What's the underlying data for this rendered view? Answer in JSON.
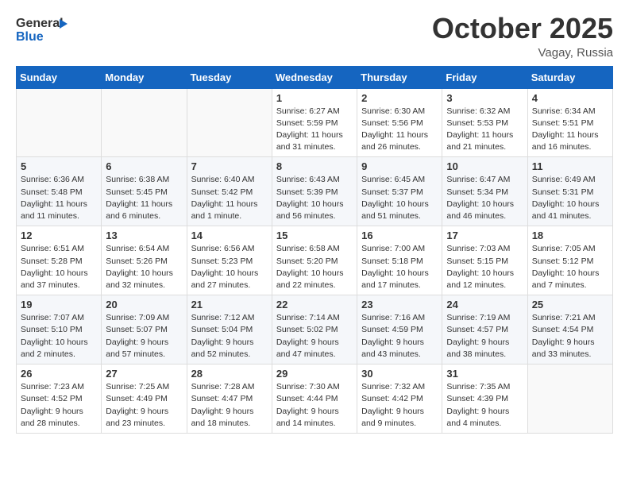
{
  "header": {
    "logo_line1": "General",
    "logo_line2": "Blue",
    "month": "October 2025",
    "location": "Vagay, Russia"
  },
  "weekdays": [
    "Sunday",
    "Monday",
    "Tuesday",
    "Wednesday",
    "Thursday",
    "Friday",
    "Saturday"
  ],
  "weeks": [
    [
      {
        "day": "",
        "info": ""
      },
      {
        "day": "",
        "info": ""
      },
      {
        "day": "",
        "info": ""
      },
      {
        "day": "1",
        "info": "Sunrise: 6:27 AM\nSunset: 5:59 PM\nDaylight: 11 hours\nand 31 minutes."
      },
      {
        "day": "2",
        "info": "Sunrise: 6:30 AM\nSunset: 5:56 PM\nDaylight: 11 hours\nand 26 minutes."
      },
      {
        "day": "3",
        "info": "Sunrise: 6:32 AM\nSunset: 5:53 PM\nDaylight: 11 hours\nand 21 minutes."
      },
      {
        "day": "4",
        "info": "Sunrise: 6:34 AM\nSunset: 5:51 PM\nDaylight: 11 hours\nand 16 minutes."
      }
    ],
    [
      {
        "day": "5",
        "info": "Sunrise: 6:36 AM\nSunset: 5:48 PM\nDaylight: 11 hours\nand 11 minutes."
      },
      {
        "day": "6",
        "info": "Sunrise: 6:38 AM\nSunset: 5:45 PM\nDaylight: 11 hours\nand 6 minutes."
      },
      {
        "day": "7",
        "info": "Sunrise: 6:40 AM\nSunset: 5:42 PM\nDaylight: 11 hours\nand 1 minute."
      },
      {
        "day": "8",
        "info": "Sunrise: 6:43 AM\nSunset: 5:39 PM\nDaylight: 10 hours\nand 56 minutes."
      },
      {
        "day": "9",
        "info": "Sunrise: 6:45 AM\nSunset: 5:37 PM\nDaylight: 10 hours\nand 51 minutes."
      },
      {
        "day": "10",
        "info": "Sunrise: 6:47 AM\nSunset: 5:34 PM\nDaylight: 10 hours\nand 46 minutes."
      },
      {
        "day": "11",
        "info": "Sunrise: 6:49 AM\nSunset: 5:31 PM\nDaylight: 10 hours\nand 41 minutes."
      }
    ],
    [
      {
        "day": "12",
        "info": "Sunrise: 6:51 AM\nSunset: 5:28 PM\nDaylight: 10 hours\nand 37 minutes."
      },
      {
        "day": "13",
        "info": "Sunrise: 6:54 AM\nSunset: 5:26 PM\nDaylight: 10 hours\nand 32 minutes."
      },
      {
        "day": "14",
        "info": "Sunrise: 6:56 AM\nSunset: 5:23 PM\nDaylight: 10 hours\nand 27 minutes."
      },
      {
        "day": "15",
        "info": "Sunrise: 6:58 AM\nSunset: 5:20 PM\nDaylight: 10 hours\nand 22 minutes."
      },
      {
        "day": "16",
        "info": "Sunrise: 7:00 AM\nSunset: 5:18 PM\nDaylight: 10 hours\nand 17 minutes."
      },
      {
        "day": "17",
        "info": "Sunrise: 7:03 AM\nSunset: 5:15 PM\nDaylight: 10 hours\nand 12 minutes."
      },
      {
        "day": "18",
        "info": "Sunrise: 7:05 AM\nSunset: 5:12 PM\nDaylight: 10 hours\nand 7 minutes."
      }
    ],
    [
      {
        "day": "19",
        "info": "Sunrise: 7:07 AM\nSunset: 5:10 PM\nDaylight: 10 hours\nand 2 minutes."
      },
      {
        "day": "20",
        "info": "Sunrise: 7:09 AM\nSunset: 5:07 PM\nDaylight: 9 hours\nand 57 minutes."
      },
      {
        "day": "21",
        "info": "Sunrise: 7:12 AM\nSunset: 5:04 PM\nDaylight: 9 hours\nand 52 minutes."
      },
      {
        "day": "22",
        "info": "Sunrise: 7:14 AM\nSunset: 5:02 PM\nDaylight: 9 hours\nand 47 minutes."
      },
      {
        "day": "23",
        "info": "Sunrise: 7:16 AM\nSunset: 4:59 PM\nDaylight: 9 hours\nand 43 minutes."
      },
      {
        "day": "24",
        "info": "Sunrise: 7:19 AM\nSunset: 4:57 PM\nDaylight: 9 hours\nand 38 minutes."
      },
      {
        "day": "25",
        "info": "Sunrise: 7:21 AM\nSunset: 4:54 PM\nDaylight: 9 hours\nand 33 minutes."
      }
    ],
    [
      {
        "day": "26",
        "info": "Sunrise: 7:23 AM\nSunset: 4:52 PM\nDaylight: 9 hours\nand 28 minutes."
      },
      {
        "day": "27",
        "info": "Sunrise: 7:25 AM\nSunset: 4:49 PM\nDaylight: 9 hours\nand 23 minutes."
      },
      {
        "day": "28",
        "info": "Sunrise: 7:28 AM\nSunset: 4:47 PM\nDaylight: 9 hours\nand 18 minutes."
      },
      {
        "day": "29",
        "info": "Sunrise: 7:30 AM\nSunset: 4:44 PM\nDaylight: 9 hours\nand 14 minutes."
      },
      {
        "day": "30",
        "info": "Sunrise: 7:32 AM\nSunset: 4:42 PM\nDaylight: 9 hours\nand 9 minutes."
      },
      {
        "day": "31",
        "info": "Sunrise: 7:35 AM\nSunset: 4:39 PM\nDaylight: 9 hours\nand 4 minutes."
      },
      {
        "day": "",
        "info": ""
      }
    ]
  ]
}
